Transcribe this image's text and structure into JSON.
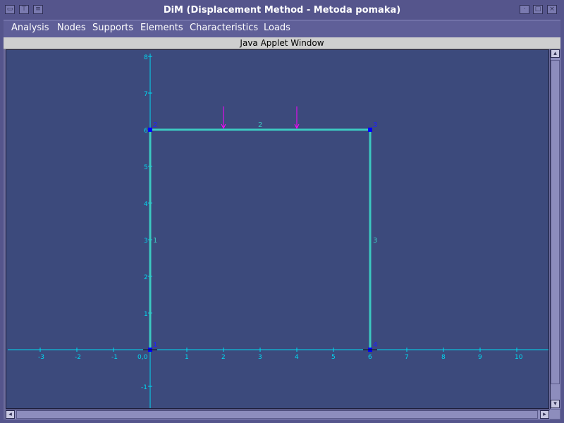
{
  "window": {
    "title": "DiM (Displacement Method - Metoda pomaka)"
  },
  "menu": {
    "items": [
      {
        "label": "Analysis"
      },
      {
        "label": "Nodes"
      },
      {
        "label": "Supports"
      },
      {
        "label": "Elements"
      },
      {
        "label": "Characteristics"
      },
      {
        "label": "Loads"
      }
    ]
  },
  "applet_banner": "Java Applet Window",
  "canvas": {
    "x_ticks": [
      "-3",
      "-2",
      "-1",
      "0,0",
      "1",
      "2",
      "3",
      "4",
      "5",
      "6",
      "7",
      "8",
      "9",
      "10"
    ],
    "y_ticks": [
      "8",
      "7",
      "6",
      "5",
      "4",
      "3",
      "2",
      "1",
      "-1"
    ],
    "nodes": [
      {
        "id": "1",
        "x": 0,
        "y": 0
      },
      {
        "id": "2",
        "x": 0,
        "y": 6
      },
      {
        "id": "3",
        "x": 6,
        "y": 6
      },
      {
        "id": "4",
        "x": 6,
        "y": 0
      }
    ],
    "elements": [
      {
        "id": "1",
        "from": "1",
        "to": "2"
      },
      {
        "id": "2",
        "from": "2",
        "to": "3"
      },
      {
        "id": "3",
        "from": "3",
        "to": "4"
      }
    ],
    "loads": [
      {
        "x": 2,
        "y": 6,
        "direction": "down"
      },
      {
        "x": 4,
        "y": 6,
        "direction": "down"
      }
    ],
    "colors": {
      "background": "#3c4a7c",
      "axis": "#00d8f0",
      "element": "#3cc8c0",
      "node": "#0000ff",
      "node_label": "#2020ff",
      "load": "#ff00ff"
    }
  }
}
